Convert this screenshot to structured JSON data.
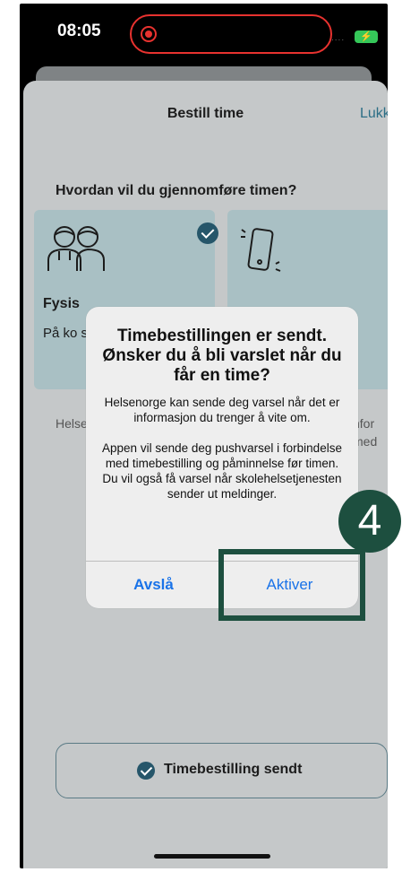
{
  "status_bar": {
    "time": "08:05",
    "signal": "....",
    "battery_icon": "battery-charging-icon"
  },
  "sheet": {
    "title": "Bestill time",
    "close_label": "Lukk",
    "question": "Hvordan vil du gjennomføre timen?",
    "option1": {
      "title": "Fysis",
      "text": "På ko skole"
    },
    "info_left": "Helse åpni tidsp",
    "info_right": "nfor med"
  },
  "alert": {
    "title": "Timebestillingen er sendt. Ønsker du å bli varslet når du får en time?",
    "message1": "Helsenorge kan sende deg varsel når det er informasjon du trenger å vite om.",
    "message2": "Appen vil sende deg pushvarsel i forbindelse med timebestilling og påminnelse før timen. Du vil også få varsel når skolehelsetjenesten sender ut meldinger.",
    "decline_label": "Avslå",
    "activate_label": "Aktiver"
  },
  "bottom_button": {
    "label": "Timebestilling sendt"
  },
  "step_badge": "4",
  "colors": {
    "accent": "#1a73e8",
    "highlight": "#1d4f3f",
    "card": "#a9c0c4"
  }
}
